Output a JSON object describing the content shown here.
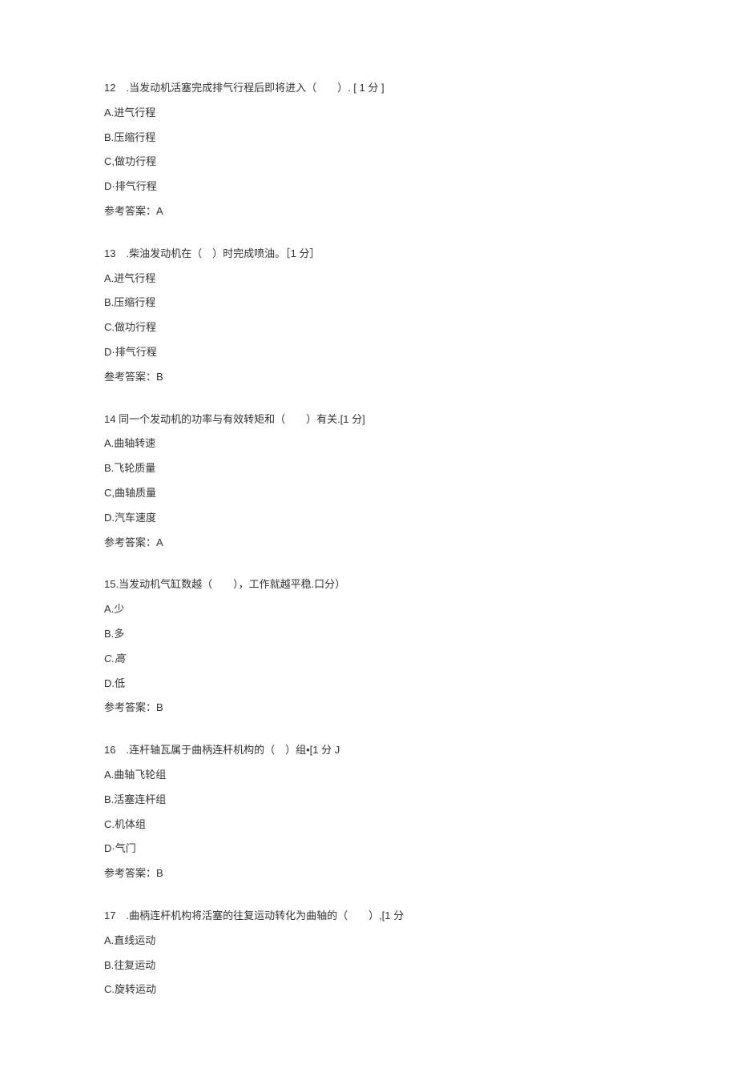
{
  "questions": [
    {
      "stem": "12　.当发动机活塞完成排气行程后即将进入（　　）. [ 1 分 ]",
      "options": [
        "A.进气行程",
        "B.压缩行程",
        "C,做功行程",
        "D·排气行程"
      ],
      "answer": "参考答案：A"
    },
    {
      "stem": "13　.柴油发动机在（　）时完成喷油。［1 分］",
      "options": [
        "A.进气行程",
        "B.压缩行程",
        "C.做功行程",
        "D·排气行程"
      ],
      "answer": "叁考答案：B"
    },
    {
      "stem": "14 同一个发动机的功率与有效转矩和（　　）有关.[1 分]",
      "options": [
        "A.曲轴转速",
        "B.飞轮质量",
        "C,曲轴质量",
        "D.汽车速度"
      ],
      "answer": "参考答案：A"
    },
    {
      "stem": "15.当发动机气缸数越（　　），工作就越平稳.口分）",
      "options": [
        "A.少",
        "B.多",
        "C.高",
        "D.低"
      ],
      "answer": "参考答案：B",
      "italic_index": 2
    },
    {
      "stem": "16　.连杆轴瓦属于曲柄连杆机构的（　）组•[1 分 J",
      "options": [
        "A.曲轴飞轮组",
        "B.活塞连杆组",
        "C.机体组",
        "D·气门"
      ],
      "answer": "参考答案：B"
    },
    {
      "stem": "17　.曲柄连杆机构将活塞的往复运动转化为曲轴的（　　）,[1 分",
      "options": [
        "A.直线运动",
        "B.往复运动",
        "C.旋转运动"
      ],
      "answer": ""
    }
  ]
}
